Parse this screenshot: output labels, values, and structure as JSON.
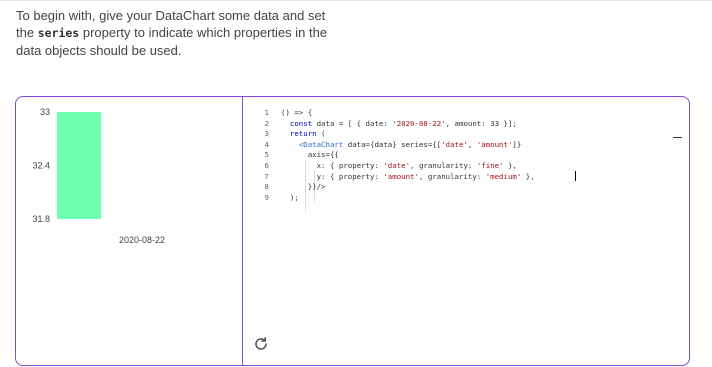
{
  "intro": {
    "text_before": "To begin with, give your DataChart some data and set the ",
    "code_word": "series",
    "text_after": " property to indicate which properties in the data objects should be used."
  },
  "chart_data": {
    "type": "bar",
    "categories": [
      "2020-08-22"
    ],
    "values": [
      33
    ],
    "ylim": [
      31.8,
      33
    ],
    "y_ticks": [
      "33",
      "32.4",
      "31.8"
    ],
    "x_label": "2020-08-22",
    "bar_color": "#6FFFB0"
  },
  "editor": {
    "line_numbers": [
      "1",
      "2",
      "3",
      "4",
      "5",
      "6",
      "7",
      "8",
      "9"
    ],
    "lines": [
      "() => {",
      "  const data = [ { date: '2020-08-22', amount: 33 }];",
      "  return (",
      "    <DataChart data={data} series={['date', 'amount']}",
      "      axis={{",
      "        x: { property: 'date', granularity: 'fine' },",
      "        y: { property: 'amount', granularity: 'medium' },",
      "      }}/>",
      "  );"
    ]
  },
  "controls": {
    "reset_icon": "refresh-icon"
  },
  "colors": {
    "accent": "#7D4CDB",
    "bar": "#6FFFB0"
  }
}
